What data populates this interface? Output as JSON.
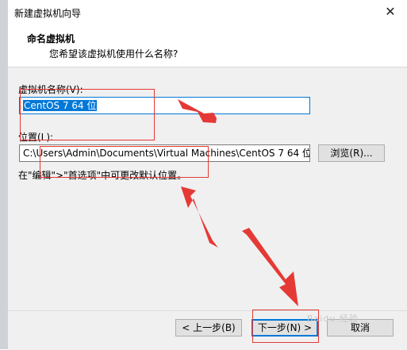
{
  "window": {
    "title": "新建虚拟机向导",
    "close_label": "✕"
  },
  "header": {
    "title": "命名虚拟机",
    "subtitle": "您希望该虚拟机使用什么名称?"
  },
  "form": {
    "vm_name_label": "虚拟机名称(V):",
    "vm_name_value": "CentOS 7 64 位",
    "location_label": "位置(L):",
    "location_value": "C:\\Users\\Admin\\Documents\\Virtual Machines\\CentOS 7 64 位",
    "browse_label": "浏览(R)...",
    "hint": "在\"编辑\">\"首选项\"中可更改默认位置。"
  },
  "footer": {
    "back_label": "< 上一步(B)",
    "next_label": "下一步(N) >",
    "cancel_label": "取消"
  },
  "watermark": "Baidu 经验",
  "colors": {
    "accent": "#0078d7",
    "annotation": "#e53935"
  }
}
